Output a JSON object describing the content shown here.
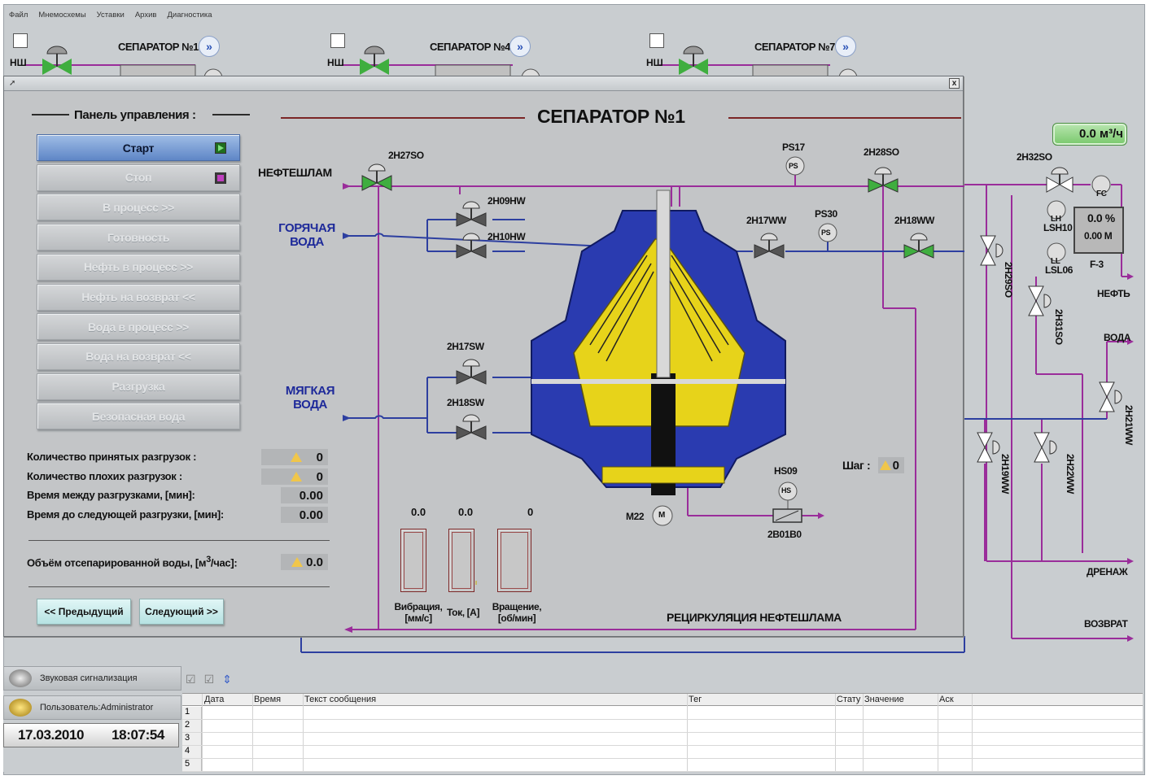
{
  "menu": [
    "Файл",
    "Мнемосхемы",
    "Уставки",
    "Архив",
    "Диагностика"
  ],
  "background": {
    "separators": [
      {
        "title": "СЕПАРАТОР №1",
        "nsh": "НШ"
      },
      {
        "title": "СЕПАРАТОР №4",
        "nsh": "НШ"
      },
      {
        "title": "СЕПАРАТОР №7",
        "nsh": "НШ"
      }
    ],
    "go_symbol": "»"
  },
  "popup": {
    "close_symbol": "x",
    "panel_title": "Панель управления :",
    "buttons": [
      {
        "label": "Старт",
        "active": true
      },
      {
        "label": "Стоп",
        "active": false
      },
      {
        "label": "В процесс  >>",
        "active": false
      },
      {
        "label": "Готовность",
        "active": false
      },
      {
        "label": "Нефть в процесс  >>",
        "active": false
      },
      {
        "label": "Нефть на возврат  <<",
        "active": false
      },
      {
        "label": "Вода в процесс  >>",
        "active": false
      },
      {
        "label": "Вода на возврат  <<",
        "active": false
      },
      {
        "label": "Разгрузка",
        "active": false
      },
      {
        "label": "Безопасная вода",
        "active": false
      }
    ],
    "stats": [
      {
        "label": "Количество принятых разгрузок :",
        "value": "0",
        "warn": true
      },
      {
        "label": "Количество плохих разгрузок :",
        "value": "0",
        "warn": true
      },
      {
        "label": "Время между разгрузками, [мин]:",
        "value": "0.00",
        "warn": false
      },
      {
        "label": "Время до следующей разгрузки, [мин]:",
        "value": "0.00",
        "warn": false
      }
    ],
    "water_volume": {
      "label": "Объём отсепарированной воды, [м",
      "sup": "3",
      "label_end": "/час]:",
      "value": "0.0"
    },
    "prev_button": "<< Предыдущий",
    "next_button": "Следующий >>",
    "title": "СЕПАРАТОР №1",
    "inputs": [
      {
        "name": "НЕФТЕШЛАМ"
      },
      {
        "name": "ГОРЯЧАЯ\nВОДА"
      },
      {
        "name": "МЯГКАЯ\nВОДА"
      }
    ],
    "valve_tags": [
      "2Н27SО",
      "2Н09НW",
      "2Н10НW",
      "2Н17SW",
      "2Н18SW",
      "2Н17WW",
      "2Н18WW",
      "2Н28SО"
    ],
    "sensors": {
      "ps17": "PS17",
      "ps30": "PS30",
      "ps": "PS",
      "hs09": "HS09",
      "hs": "HS",
      "motor": "M22",
      "m": "M",
      "valve_hs": "2В01В0"
    },
    "step_label": "Шаг :",
    "step_value": "0",
    "gauges": [
      {
        "value": "0.0",
        "label": "Вибрация,\n[мм/с]"
      },
      {
        "value": "0.0",
        "label": "Ток, [А]"
      },
      {
        "value": "0",
        "label": "Вращение,\n[об/мин]"
      }
    ],
    "recirc_label": "РЕЦИРКУЛЯЦИЯ НЕФТЕШЛАМА"
  },
  "right": {
    "flow": "0.0 м³/ч",
    "fc": "FC",
    "tag_2h32": "2Н32SО",
    "lh": "LH",
    "ll": "LL",
    "lsh": "LSH10",
    "lsl": "LSL06",
    "level_pct": "0.0 %",
    "level_m": "0.00 М",
    "f3": "F-3",
    "neft": "НЕФТЬ",
    "voda": "ВОДА",
    "drenazh": "ДРЕНАЖ",
    "vozvrat": "ВОЗВРАТ",
    "v_2h29": "2Н29SО",
    "v_2h31": "2Н31SО",
    "v_2h21": "2Н21WW",
    "v_2h19": "2Н19WW",
    "v_2h22": "2Н22WW"
  },
  "alarm": {
    "sound": "Звуковая сигнализация",
    "user": "Пользователь:Administrator",
    "date": "17.03.2010",
    "time": "18:07:54",
    "columns": [
      "Дата",
      "Время",
      "Текст сообщения",
      "Тег",
      "Стату",
      "Значение",
      "Аск"
    ],
    "rows": [
      "1",
      "2",
      "3",
      "4",
      "5"
    ]
  },
  "colors": {
    "pipe_purple": "#9a2d9a",
    "pipe_blue": "#2d3fa0",
    "valve_green": "#3fae3f",
    "sep_blue": "#2a3bb0",
    "sep_yellow": "#e7d31a"
  }
}
